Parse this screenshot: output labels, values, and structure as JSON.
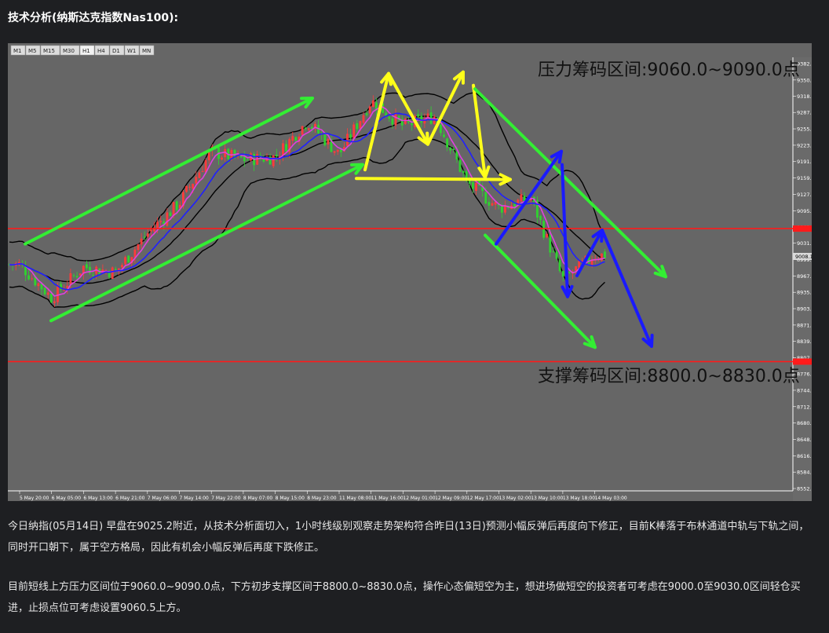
{
  "heading": "技术分析(纳斯达克指数Nas100):",
  "colors": {
    "background": "#666666",
    "candle_up": "#ff3b3b",
    "candle_down": "#2fd32f",
    "ma_fast": "#e040e0",
    "ma_slow": "#2020ff",
    "bollinger": "#000000",
    "level_line": "#ff1a1a",
    "arrow_green": "#33ee33",
    "arrow_yellow": "#ffff1a",
    "arrow_blue": "#1a1aff"
  },
  "chart_data": {
    "type": "candlestick",
    "timeframes": [
      "M1",
      "M5",
      "M15",
      "M30",
      "H1",
      "H4",
      "D1",
      "W1",
      "MN"
    ],
    "active_timeframe": "H1",
    "ylim": [
      8552.0,
      9382.5
    ],
    "y_ticks": [
      "9382.5",
      "9350.5",
      "9318.5",
      "9287.0",
      "9255.0",
      "9223.0",
      "9191.0",
      "9159.0",
      "9127.0",
      "9095.0",
      "9063.0",
      "9031.5",
      "8999.5",
      "8967.5",
      "8935.5",
      "8903.5",
      "8871.5",
      "8839.5",
      "8807.5",
      "8776.0",
      "8744.0",
      "8712.0",
      "8680.0",
      "8648.0",
      "8616.0",
      "8584.0",
      "8552.0"
    ],
    "x_ticks": [
      "5 May 20:00",
      "6 May 05:00",
      "6 May 13:00",
      "6 May 21:00",
      "7 May 06:00",
      "7 May 14:00",
      "7 May 22:00",
      "8 May 07:00",
      "8 May 15:00",
      "8 May 23:00",
      "11 May 08:00",
      "11 May 16:00",
      "12 May 01:00",
      "12 May 09:00",
      "12 May 17:00",
      "13 May 02:00",
      "13 May 10:00",
      "13 May 18:00",
      "14 May 03:00"
    ],
    "current_price_label": "9008.1",
    "resistance_line": 9060.0,
    "support_line": 8800.0,
    "resistance_label": "压力筹码区间:9060.0~9090.0点",
    "support_label": "支撑筹码区间:8800.0~8830.0点",
    "close_path": [
      {
        "x": "5 May 20:00",
        "y": 8990
      },
      {
        "x": "6 May 05:00",
        "y": 8925
      },
      {
        "x": "6 May 13:00",
        "y": 8985
      },
      {
        "x": "6 May 21:00",
        "y": 8975
      },
      {
        "x": "7 May 06:00",
        "y": 9050
      },
      {
        "x": "7 May 14:00",
        "y": 9110
      },
      {
        "x": "7 May 22:00",
        "y": 9210
      },
      {
        "x": "8 May 07:00",
        "y": 9195
      },
      {
        "x": "8 May 15:00",
        "y": 9200
      },
      {
        "x": "8 May 23:00",
        "y": 9270
      },
      {
        "x": "11 May 08:00",
        "y": 9205
      },
      {
        "x": "11 May 16:00",
        "y": 9310
      },
      {
        "x": "12 May 01:00",
        "y": 9260
      },
      {
        "x": "12 May 09:00",
        "y": 9280
      },
      {
        "x": "12 May 17:00",
        "y": 9150
      },
      {
        "x": "13 May 02:00",
        "y": 9100
      },
      {
        "x": "13 May 10:00",
        "y": 9120
      },
      {
        "x": "13 May 18:00",
        "y": 8960
      },
      {
        "x": "14 May 03:00",
        "y": 9008
      }
    ]
  },
  "paragraph_1": "今日纳指(05月14日) 早盘在9025.2附近，从技术分析面切入，1小时线级别观察走势架构符合昨日(13日)预测小幅反弹后再度向下修正，目前K棒落于布林通道中轨与下轨之间，同时开口朝下，属于空方格局，因此有机会小幅反弹后再度下跌修正。",
  "paragraph_2": "目前短线上方压力区间位于9060.0~9090.0点，下方初步支撑区间于8800.0~8830.0点，操作心态偏短空为主，想进场做短空的投资者可考虑在9000.0至9030.0区间轻仓买进，止损点位可考虑设置9060.5上方。"
}
